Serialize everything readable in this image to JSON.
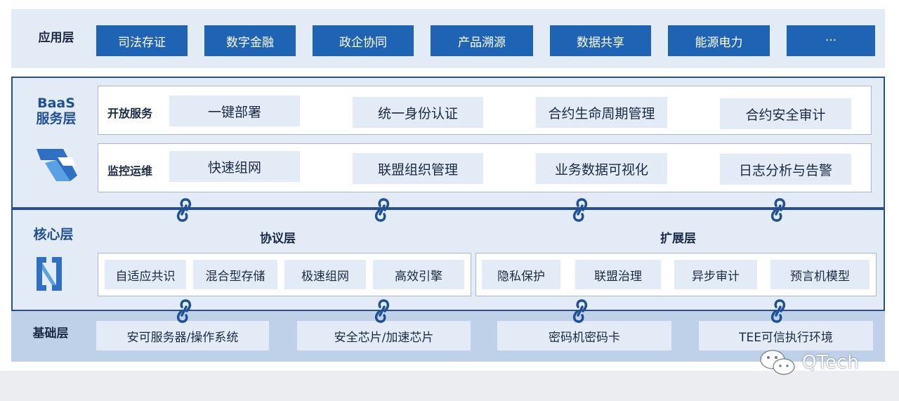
{
  "app_layer": {
    "title": "应用层",
    "items": [
      "司法存证",
      "数字金融",
      "政企协同",
      "产品溯源",
      "数据共享",
      "能源电力",
      "···"
    ],
    "button_color": "#1f64b4"
  },
  "baas_layer": {
    "title_line1": "BaaS",
    "title_line2": "服务层",
    "logo_icon": "baas-logo-icon",
    "rows": [
      {
        "label": "开放服务",
        "items": [
          "一键部署",
          "统一身份认证",
          "合约生命周期管理",
          "合约安全审计"
        ]
      },
      {
        "label": "监控运维",
        "items": [
          "快速组网",
          "联盟组织管理",
          "业务数据可视化",
          "日志分析与告警"
        ]
      }
    ]
  },
  "core_layer": {
    "title": "核心层",
    "logo_icon": "core-logo-icon",
    "protocol": {
      "title": "协议层",
      "items": [
        "自适应共识",
        "混合型存储",
        "极速组网",
        "高效引擎"
      ]
    },
    "extension": {
      "title": "扩展层",
      "items": [
        "隐私保护",
        "联盟治理",
        "异步审计",
        "预言机模型"
      ]
    }
  },
  "base_layer": {
    "title": "基础层",
    "items": [
      "安可服务器/操作系统",
      "安全芯片/加速芯片",
      "密码机密码卡",
      "TEE可信执行环境"
    ]
  },
  "connector_icon": "chain-link-icon",
  "watermark": {
    "text": "QTech",
    "icon": "wechat-icon"
  },
  "colors": {
    "band": "#e3ecf6",
    "border": "#2a4f8e",
    "base_band": "#bfd1e9",
    "text": "#1b2a44"
  }
}
